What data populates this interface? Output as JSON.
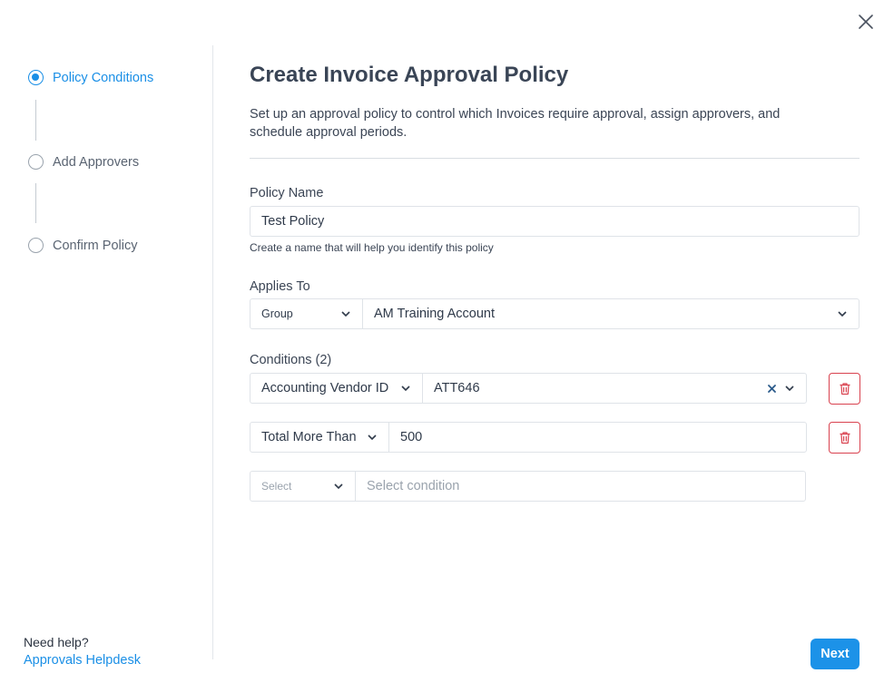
{
  "dialog": {
    "close_icon": "close-icon"
  },
  "sidebar": {
    "steps": [
      {
        "label": "Policy Conditions",
        "active": true
      },
      {
        "label": "Add Approvers",
        "active": false
      },
      {
        "label": "Confirm Policy",
        "active": false
      }
    ],
    "help_title": "Need help?",
    "help_link": "Approvals Helpdesk"
  },
  "main": {
    "title": "Create Invoice Approval Policy",
    "description": "Set up an approval policy to control which Invoices require approval, assign approvers, and schedule approval periods.",
    "policy_name": {
      "label": "Policy Name",
      "value": "Test Policy",
      "hint": "Create a name that will help you identify this policy"
    },
    "applies_to": {
      "label": "Applies To",
      "type_value": "Group",
      "target_value": "AM Training Account"
    },
    "conditions": {
      "label": "Conditions (2)",
      "rows": [
        {
          "field": "Accounting Vendor ID",
          "value": "ATT646"
        },
        {
          "field": "Total More Than",
          "value": "500"
        }
      ],
      "new_row": {
        "field_placeholder": "Select",
        "value_placeholder": "Select condition"
      }
    },
    "next_label": "Next"
  },
  "colors": {
    "accent": "#1a8fe6",
    "danger": "#d9424f",
    "text": "#3b4555"
  }
}
